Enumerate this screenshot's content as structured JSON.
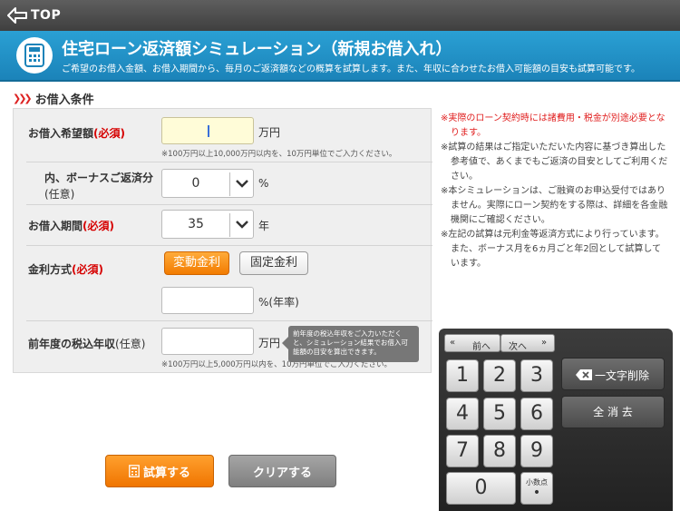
{
  "topbar": {
    "back_label": "TOP"
  },
  "header": {
    "title": "住宅ローン返済額シミュレーション（新規お借入れ）",
    "subtitle": "ご希望のお借入金額、お借入期間から、毎月のご返済額などの概算を試算します。また、年収に合わせたお借入可能額の目安も試算可能です。"
  },
  "section": {
    "title": "お借入条件"
  },
  "form": {
    "amount": {
      "label": "お借入希望額",
      "required": "(必須)",
      "value": "",
      "unit": "万円",
      "note": "※100万円以上10,000万円以内を、10万円単位でご入力ください。"
    },
    "bonus": {
      "label": "内、ボーナスご返済分",
      "optional": "(任意)",
      "value": "0",
      "unit": "%"
    },
    "period": {
      "label": "お借入期間",
      "required": "(必須)",
      "value": "35",
      "unit": "年"
    },
    "rate_type": {
      "label": "金利方式",
      "required": "(必須)",
      "option_variable": "変動金利",
      "option_fixed": "固定金利",
      "selected": "変動金利",
      "rate_value": "",
      "rate_unit": "%(年率)"
    },
    "income": {
      "label": "前年度の税込年収",
      "optional": "(任意)",
      "value": "",
      "unit": "万円",
      "note": "※100万円以上5,000万円以内を、10万円単位でご入力ください。",
      "tooltip": "前年度の税込年収をご入力いただくと、シミュレーション結果でお借入可能額の目安を算出できます。"
    }
  },
  "notes": [
    {
      "text": "※実際のローン契約時には諸費用・税金が別途必要となります。",
      "color": "#e01e1e"
    },
    {
      "text": "※試算の結果はご指定いただいた内容に基づき算出した参考値で、あくまでもご返済の目安としてご利用ください。"
    },
    {
      "text": "※本シミュレーションは、ご融資のお申込受付ではありません。実際にローン契約をする際は、詳細を各金融機関にご確認ください。"
    },
    {
      "text": "※左記の試算は元利金等返済方式により行っています。また、ボーナス月を6ヵ月ごと年2回として試算しています。"
    }
  ],
  "keypad": {
    "prev": "前へ",
    "next": "次へ",
    "keys": [
      "1",
      "2",
      "3",
      "4",
      "5",
      "6",
      "7",
      "8",
      "9",
      "0"
    ],
    "decimal_label": "小数点",
    "delete_label": "一文字削除",
    "clear_all_label": "全 消 去"
  },
  "actions": {
    "calculate": "試算する",
    "clear": "クリアする"
  },
  "colors": {
    "header_blue": "#1b83b9",
    "accent_orange": "#f27b00",
    "required_red": "#d60000"
  }
}
